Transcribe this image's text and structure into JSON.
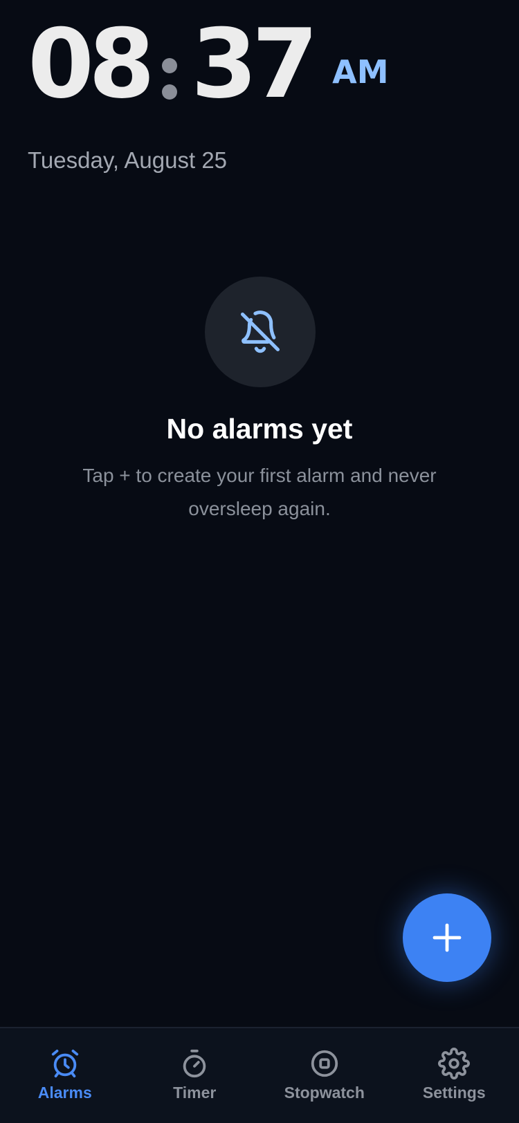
{
  "clock": {
    "hours": "08",
    "minutes": "37",
    "period": "AM"
  },
  "date": "Tuesday, August 25",
  "empty_state": {
    "icon": "bell-off-icon",
    "title": "No alarms yet",
    "description": "Tap + to create your first alarm and never oversleep again."
  },
  "fab": {
    "icon": "plus-icon"
  },
  "nav": {
    "items": [
      {
        "label": "Alarms",
        "icon": "alarm-clock-icon",
        "active": true
      },
      {
        "label": "Timer",
        "icon": "timer-icon",
        "active": false
      },
      {
        "label": "Stopwatch",
        "icon": "stopwatch-icon",
        "active": false
      },
      {
        "label": "Settings",
        "icon": "gear-icon",
        "active": false
      }
    ]
  },
  "colors": {
    "background": "#070b14",
    "accent": "#3d82f3",
    "accent_light": "#8ec0ff",
    "nav_background": "#0c121d",
    "inactive": "#8d929c"
  }
}
